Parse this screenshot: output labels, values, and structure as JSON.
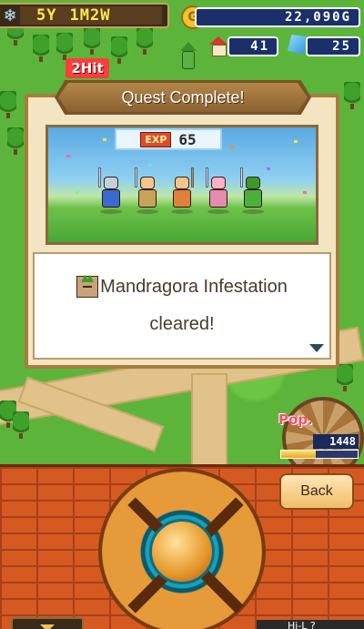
{
  "hud": {
    "year": "5Y",
    "month_week": "1M2W",
    "gold": "22,090G",
    "houses": "41",
    "crystals": "25",
    "icons": {
      "season": "snowflake-icon",
      "gold": "coin-icon",
      "houses": "house-icon",
      "crystals": "crystal-icon"
    }
  },
  "combo": {
    "label": "2Hit"
  },
  "dialog": {
    "title": "Quest Complete!",
    "exp_label": "EXP",
    "exp_value": "65",
    "message_line1": "Mandragora Infestation",
    "message_line2": "cleared!"
  },
  "population": {
    "label": "Pop.",
    "value": "1448",
    "level": 0.45
  },
  "controls": {
    "back_label": "Back",
    "corner_text": "Hi-L ?"
  },
  "colors": {
    "accent_brick": "#d45a22",
    "panel_bg": "#f3e4c2",
    "banner": "#8a6130",
    "hud_bar": "#1b2f6a"
  }
}
